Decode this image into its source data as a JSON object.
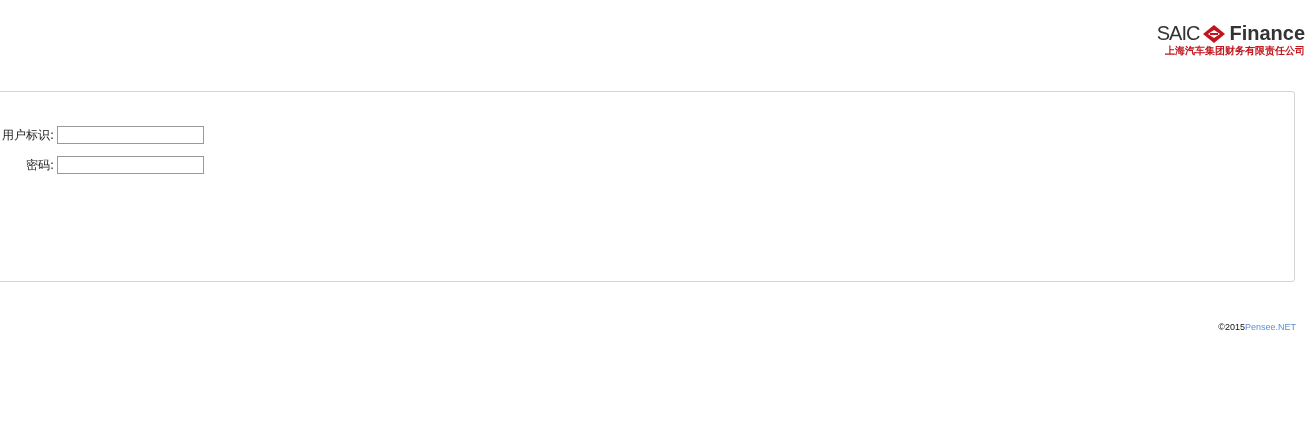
{
  "logo": {
    "brand": "SAIC",
    "name": "Finance",
    "subtitle": "上海汽车集团财务有限责任公司"
  },
  "login_form": {
    "fields": [
      {
        "label": "用户标识:"
      },
      {
        "label": "密码:"
      }
    ]
  },
  "footer": {
    "copyright": "©2015",
    "link": "Pensee.NET"
  }
}
